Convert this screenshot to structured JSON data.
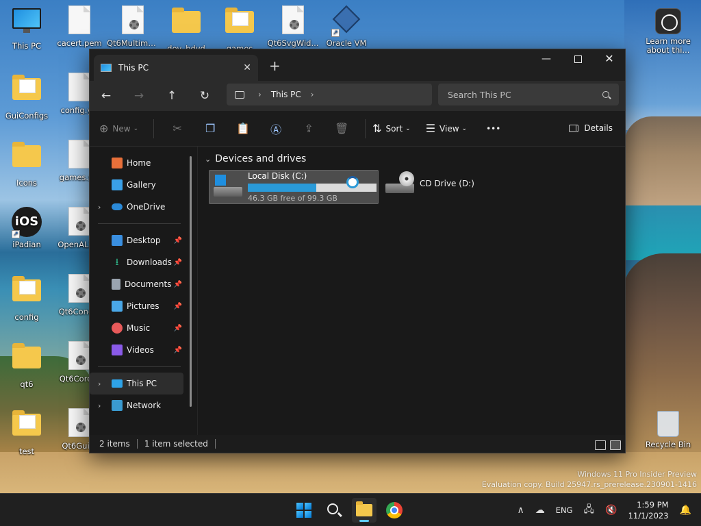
{
  "desktop": {
    "icons": [
      {
        "label": "This PC"
      },
      {
        "label": "cacert.pem"
      },
      {
        "label": "Qt6Multime..."
      },
      {
        "label": "dev_bdvd"
      },
      {
        "label": "games"
      },
      {
        "label": "Qt6SvgWid..."
      },
      {
        "label": "Oracle VM"
      },
      {
        "label": "GuiConfigs"
      },
      {
        "label": "config.y..."
      },
      {
        "label": "Icons"
      },
      {
        "label": "games.y..."
      },
      {
        "label": "iPadian"
      },
      {
        "label": "OpenAL3..."
      },
      {
        "label": "config"
      },
      {
        "label": "Qt6Conc..."
      },
      {
        "label": "qt6"
      },
      {
        "label": "Qt6Core..."
      },
      {
        "label": "test"
      },
      {
        "label": "Qt6Gui..."
      },
      {
        "label": "Learn more about thi..."
      },
      {
        "label": "Recycle Bin"
      }
    ],
    "ios_icon_text": "iOS",
    "watermark": {
      "line1": "Windows 11 Pro Insider Preview",
      "line2": "Evaluation copy. Build 25947.rs_prerelease.230901-1416"
    }
  },
  "window": {
    "tab_title": "This PC",
    "tab_close": "✕",
    "new_tab": "+",
    "controls": {
      "minimize": "—",
      "close": "✕"
    },
    "nav": {
      "back": "←",
      "forward": "→",
      "up": "↑",
      "refresh": "↻"
    },
    "address": {
      "location": "This PC",
      "sep": "›",
      "sep2": "›"
    },
    "search": {
      "placeholder": "Search This PC"
    },
    "commands": {
      "new_label": "New",
      "sort_label": "Sort",
      "view_label": "View",
      "more_label": "•••",
      "details_label": "Details"
    },
    "sidebar": {
      "items": [
        {
          "label": "Home",
          "color": "#e8703a"
        },
        {
          "label": "Gallery",
          "color": "#3aa0e8"
        },
        {
          "label": "OneDrive",
          "color": "#2b8ad8"
        },
        {
          "label": "Desktop",
          "color": "#3a8fe0"
        },
        {
          "label": "Downloads",
          "color": "#2fb88a"
        },
        {
          "label": "Documents",
          "color": "#9aa4b0"
        },
        {
          "label": "Pictures",
          "color": "#4aa8e8"
        },
        {
          "label": "Music",
          "color": "#e85a5a"
        },
        {
          "label": "Videos",
          "color": "#8a5ae8"
        },
        {
          "label": "This PC",
          "color": "#2ea3e8"
        },
        {
          "label": "Network",
          "color": "#3a9ad0"
        }
      ]
    },
    "content": {
      "group_title": "Devices and drives",
      "drives": [
        {
          "name": "Local Disk (C:)",
          "free": "46.3 GB free of 99.3 GB",
          "used_fraction": 0.534
        },
        {
          "name": "CD Drive (D:)"
        }
      ]
    },
    "status": {
      "items": "2 items",
      "selected": "1 item selected"
    }
  },
  "taskbar": {
    "lang": "ENG",
    "time": "1:59 PM",
    "date": "11/1/2023",
    "caret": "∧"
  }
}
